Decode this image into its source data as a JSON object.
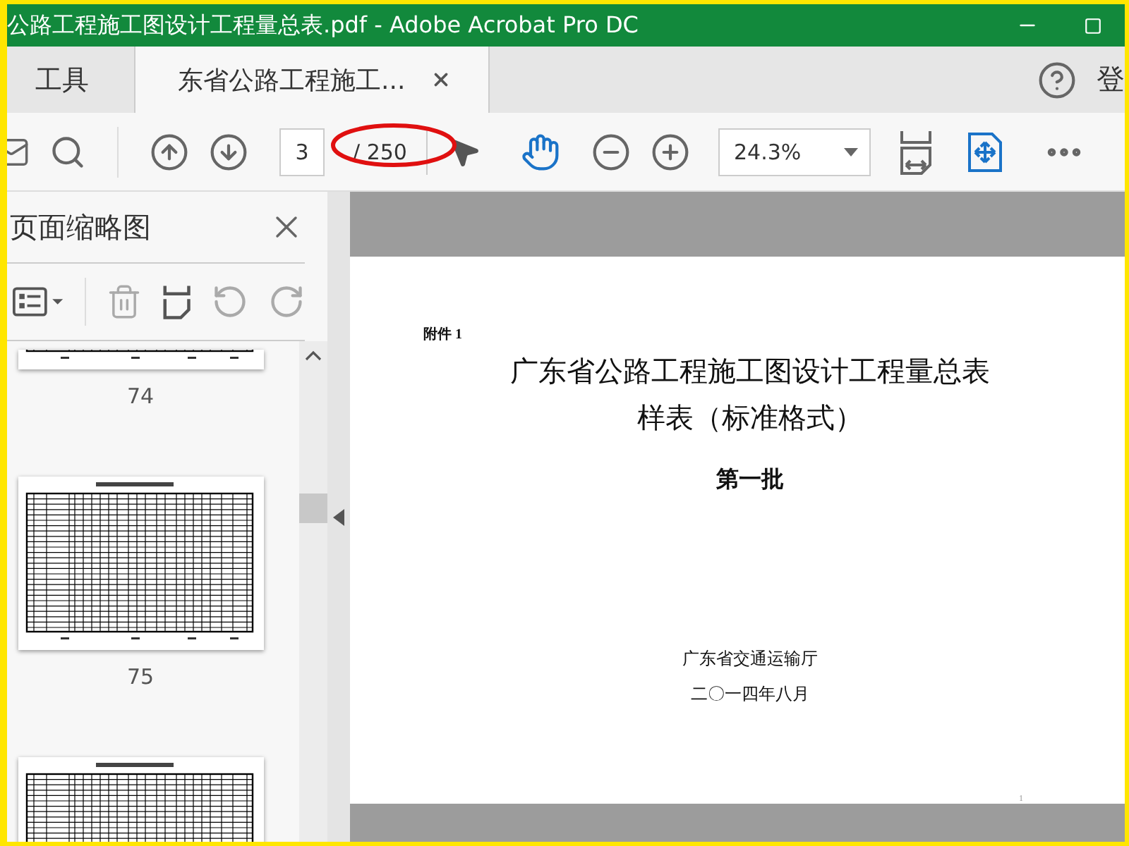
{
  "window": {
    "title": "公路工程施工图设计工程量总表.pdf - Adobe Acrobat Pro DC"
  },
  "tabs": [
    {
      "label": "工具",
      "selected": false
    },
    {
      "label": "东省公路工程施工...",
      "selected": true
    }
  ],
  "account": {
    "label": "登"
  },
  "toolbar": {
    "page": "3",
    "page_count": "/ 250",
    "zoom": "24.3%"
  },
  "thumbnails_panel": {
    "title": "页面缩略图",
    "thumbnails": [
      {
        "kind": "cut-top",
        "label": "74"
      },
      {
        "kind": "full",
        "label": "75"
      },
      {
        "kind": "cut-bottom"
      }
    ]
  },
  "document": {
    "lines": [
      {
        "kind": "annex",
        "text": "附件 1"
      },
      {
        "kind": "title",
        "text": "广东省公路工程施工图设计工程量总表"
      },
      {
        "kind": "title",
        "text": "样表（标准格式）"
      },
      {
        "kind": "subtitle",
        "text": "第一批"
      },
      {
        "kind": "issuer",
        "text": "广东省交通运输厅"
      },
      {
        "kind": "date",
        "text": "二〇一四年八月"
      }
    ],
    "page_number": "1"
  }
}
